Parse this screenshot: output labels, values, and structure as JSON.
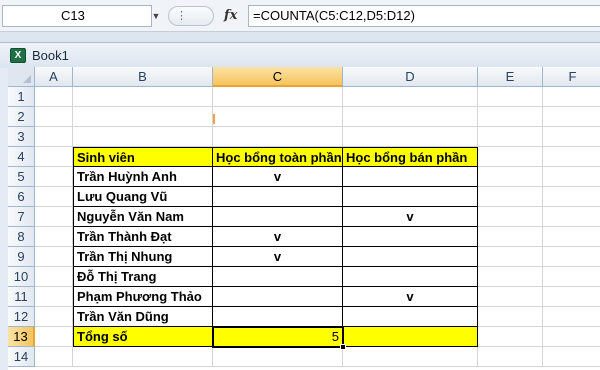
{
  "formula_bar": {
    "name_box": "C13",
    "fx_label": "fx",
    "formula": "=COUNTA(C5:C12,D5:D12)"
  },
  "workbook": {
    "title": "Book1",
    "icon": "excel-icon"
  },
  "columns": [
    "A",
    "B",
    "C",
    "D",
    "E",
    "F"
  ],
  "rows": [
    "1",
    "2",
    "3",
    "4",
    "5",
    "6",
    "7",
    "8",
    "9",
    "10",
    "11",
    "12",
    "13",
    "14"
  ],
  "selection": {
    "cell": "C13",
    "column": "C",
    "row": "13"
  },
  "table": {
    "headers": [
      "Sinh viên",
      "Học bổng toàn phần",
      "Học bổng bán phần"
    ],
    "students": [
      {
        "name": "Trần Huỳnh Anh",
        "full": "v",
        "half": ""
      },
      {
        "name": "Lưu Quang Vũ",
        "full": "",
        "half": ""
      },
      {
        "name": "Nguyễn Văn Nam",
        "full": "",
        "half": "v"
      },
      {
        "name": "Trần Thành Đạt",
        "full": "v",
        "half": ""
      },
      {
        "name": "Trần Thị Nhung",
        "full": "v",
        "half": ""
      },
      {
        "name": "Đỗ Thị Trang",
        "full": "",
        "half": ""
      },
      {
        "name": "Phạm Phương Thảo",
        "full": "",
        "half": "v"
      },
      {
        "name": "Trần Văn Dũng",
        "full": "",
        "half": ""
      }
    ],
    "total_label": "Tổng số",
    "total_value": "5"
  },
  "colors": {
    "header_fill": "#ffff00",
    "selection_highlight": "#f7c45e",
    "grid_line": "#d4d4d4"
  }
}
